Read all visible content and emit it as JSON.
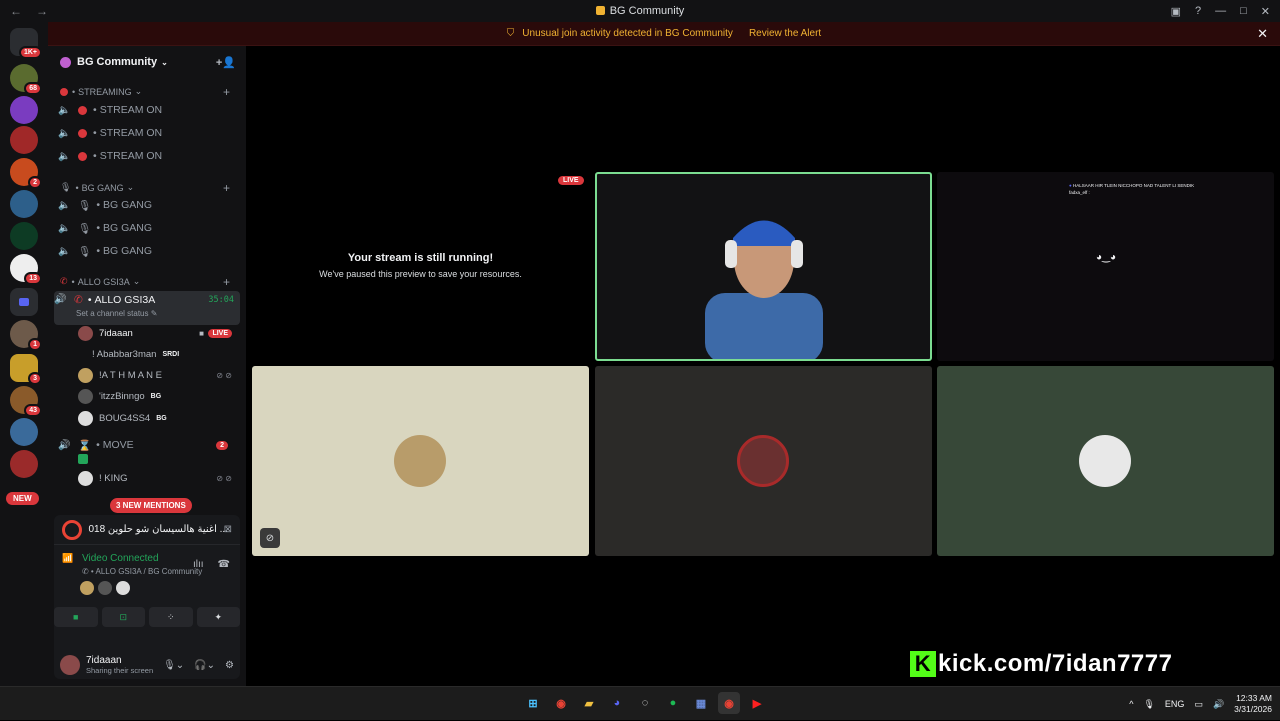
{
  "window": {
    "title": "BG Community"
  },
  "alert": {
    "text": "Unusual join activity detected in BG Community",
    "link": "Review the Alert"
  },
  "rail": {
    "top_badge": "1K+",
    "badges": [
      "68",
      "2",
      "13",
      "1",
      "3",
      "43"
    ],
    "new_label": "NEW"
  },
  "server": {
    "name": "BG Community"
  },
  "categories": {
    "streaming": "STREAMING",
    "bg_gang": "BG GANG",
    "allo": "ALLO GSI3A"
  },
  "stream_channels": [
    "STREAM ON",
    "STREAM ON",
    "STREAM ON"
  ],
  "gang_channels": [
    "BG GANG",
    "BG GANG",
    "BG GANG"
  ],
  "active_channel": {
    "name": "ALLO GSI3A",
    "timer": "35:04",
    "status": "Set a channel status"
  },
  "voice_users": [
    {
      "name": "7idaaan",
      "live": "LIVE"
    },
    {
      "name": "! Ababbar3man",
      "tag": "SRDI"
    },
    {
      "name": "!A T H M A N E"
    },
    {
      "name": "'itzzBinngo",
      "tag": "BG"
    },
    {
      "name": "BOUG4SS4",
      "tag": "BG"
    }
  ],
  "move_channel": {
    "name": "MOVE",
    "badge": "2"
  },
  "move_users": [
    {
      "name": "! KING"
    }
  ],
  "mentions": "3 NEW MENTIONS",
  "now_playing": "... أغنية هالسيسان شو حلوين 2018 (25041)",
  "voice": {
    "status": "Video Connected",
    "channel": "ALLO GSI3A / BG Community"
  },
  "user": {
    "name": "7idaaan",
    "status": "Sharing their screen"
  },
  "stage": {
    "live_label": "LIVE",
    "paused_title": "Your stream is still running!",
    "paused_sub": "We've paused this preview to save your resources.",
    "chat_line1": "HALSAAR HIR TLEIN NICCHOPO NAD TALENT LI SENDIK",
    "chat_line2": "fadxa_elf :"
  },
  "overlay": {
    "kick_text": "kick.com/7idan7777"
  },
  "tray": {
    "lang": "ENG",
    "time": "12:33 AM",
    "date": "3/31/2026"
  },
  "colors": {
    "accent_red": "#da373c",
    "connected_green": "#23a55a",
    "kick_green": "#53fc18",
    "alert_text": "#f0b232"
  }
}
